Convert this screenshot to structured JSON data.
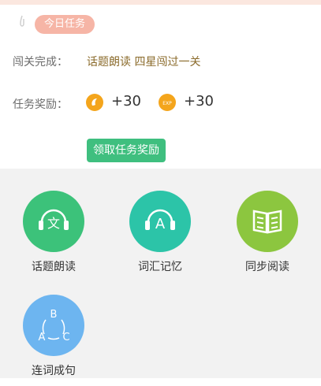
{
  "task": {
    "badge": "今日任务",
    "pass_label": "闯关完成：",
    "pass_value": "话题朗读 四星闯过一关",
    "reward_label": "任务奖励：",
    "rewards": [
      {
        "icon": "coin-icon",
        "amount": "+30",
        "color": "#f4a51c"
      },
      {
        "icon": "exp-icon",
        "amount": "+30",
        "color": "#f4a51c"
      }
    ],
    "claim_button": "领取任务奖励"
  },
  "modules": [
    {
      "label": "话题朗读",
      "icon": "topic-reading-icon",
      "glyph": "文",
      "color": "#3cc27a"
    },
    {
      "label": "词汇记忆",
      "icon": "vocabulary-icon",
      "glyph": "A",
      "color": "#2cc4a8"
    },
    {
      "label": "同步阅读",
      "icon": "book-icon",
      "color": "#8cc63f"
    },
    {
      "label": "连词成句",
      "icon": "word-link-icon",
      "letters": [
        "B",
        "A",
        "C"
      ],
      "color": "#6db5f0"
    }
  ]
}
